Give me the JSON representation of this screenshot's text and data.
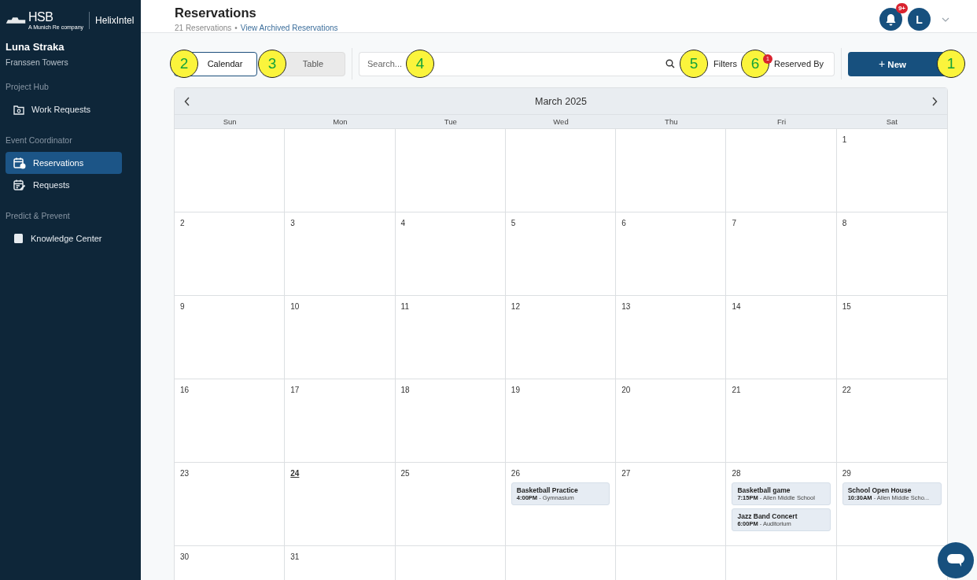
{
  "sidebar": {
    "logo": {
      "brand": "HSB",
      "tagline": "A Munich Re company",
      "product_bold": "Helix",
      "product_light": "Intel"
    },
    "user": {
      "name": "Luna Straka",
      "site": "Franssen Towers"
    },
    "sections": [
      {
        "label": "Project Hub",
        "items": [
          {
            "label": "Work Requests",
            "selected": false
          }
        ]
      },
      {
        "label": "Event Coordinator",
        "items": [
          {
            "label": "Reservations",
            "selected": true
          },
          {
            "label": "Requests",
            "selected": false
          }
        ]
      },
      {
        "label": "Predict & Prevent",
        "items": [
          {
            "label": "Knowledge Center",
            "selected": false
          }
        ]
      }
    ]
  },
  "header": {
    "title": "Reservations",
    "count": "21 Reservations",
    "separator": "•",
    "archive_link": "View Archived Reservations",
    "notification_badge": "9+",
    "avatar_initial": "L"
  },
  "toolbar": {
    "view_tabs": [
      {
        "label": "Calendar",
        "selected": true,
        "callout": "2"
      },
      {
        "label": "Table",
        "selected": false,
        "callout": "3"
      }
    ],
    "search": {
      "placeholder": "Search...",
      "callout": "4"
    },
    "filters": {
      "label": "Filters",
      "callout": "5"
    },
    "reserved_by": {
      "label": "Reserved By",
      "badge": "1",
      "callout": "6"
    },
    "new_button": {
      "icon": "+",
      "label": "New",
      "callout": "1"
    }
  },
  "calendar": {
    "month": "March 2025",
    "weekdays": [
      "Sun",
      "Mon",
      "Tue",
      "Wed",
      "Thu",
      "Fri",
      "Sat"
    ],
    "weeks": [
      {
        "kind": "month-start",
        "days": [
          {
            "day": "1",
            "today": false
          }
        ]
      },
      {
        "kind": "full",
        "days": [
          {
            "day": "2",
            "today": false
          },
          {
            "day": "3",
            "today": false
          },
          {
            "day": "4",
            "today": false
          },
          {
            "day": "5",
            "today": false
          },
          {
            "day": "6",
            "today": false
          },
          {
            "day": "7",
            "today": false
          },
          {
            "day": "8",
            "today": false
          }
        ]
      },
      {
        "kind": "full",
        "days": [
          {
            "day": "9",
            "today": false
          },
          {
            "day": "10",
            "today": false
          },
          {
            "day": "11",
            "today": false
          },
          {
            "day": "12",
            "today": false
          },
          {
            "day": "13",
            "today": false
          },
          {
            "day": "14",
            "today": false
          },
          {
            "day": "15",
            "today": false
          }
        ]
      },
      {
        "kind": "full",
        "days": [
          {
            "day": "16",
            "today": false
          },
          {
            "day": "17",
            "today": false
          },
          {
            "day": "18",
            "today": false
          },
          {
            "day": "19",
            "today": false
          },
          {
            "day": "20",
            "today": false
          },
          {
            "day": "21",
            "today": false
          },
          {
            "day": "22",
            "today": false
          }
        ]
      },
      {
        "kind": "full",
        "days": [
          {
            "day": "23",
            "today": false
          },
          {
            "day": "24",
            "today": true
          },
          {
            "day": "25",
            "today": false
          },
          {
            "day": "26",
            "today": false,
            "events": [
              {
                "title": "Basketball Practice",
                "time": "4:00PM",
                "place": "- Gymnasium"
              }
            ]
          },
          {
            "day": "27",
            "today": false
          },
          {
            "day": "28",
            "today": false,
            "events": [
              {
                "title": "Basketball game",
                "time": "7:15PM",
                "place": "- Allen Middle School"
              },
              {
                "title": "Jazz Band Concert",
                "time": "6:00PM",
                "place": "- Auditorium"
              }
            ]
          },
          {
            "day": "29",
            "today": false,
            "events": [
              {
                "title": "School Open House",
                "time": "10:30AM",
                "place": "- Allen Middle Scho..."
              }
            ]
          }
        ]
      },
      {
        "kind": "month-end",
        "days": [
          {
            "day": "30",
            "today": false
          },
          {
            "day": "31",
            "today": false
          }
        ]
      }
    ]
  }
}
